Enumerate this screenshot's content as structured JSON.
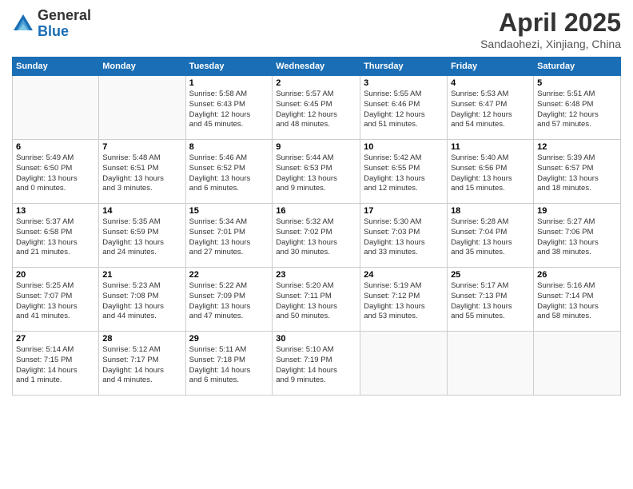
{
  "logo": {
    "general": "General",
    "blue": "Blue"
  },
  "title": "April 2025",
  "location": "Sandaohezi, Xinjiang, China",
  "weekdays": [
    "Sunday",
    "Monday",
    "Tuesday",
    "Wednesday",
    "Thursday",
    "Friday",
    "Saturday"
  ],
  "weeks": [
    [
      {
        "day": "",
        "info": ""
      },
      {
        "day": "",
        "info": ""
      },
      {
        "day": "1",
        "info": "Sunrise: 5:58 AM\nSunset: 6:43 PM\nDaylight: 12 hours\nand 45 minutes."
      },
      {
        "day": "2",
        "info": "Sunrise: 5:57 AM\nSunset: 6:45 PM\nDaylight: 12 hours\nand 48 minutes."
      },
      {
        "day": "3",
        "info": "Sunrise: 5:55 AM\nSunset: 6:46 PM\nDaylight: 12 hours\nand 51 minutes."
      },
      {
        "day": "4",
        "info": "Sunrise: 5:53 AM\nSunset: 6:47 PM\nDaylight: 12 hours\nand 54 minutes."
      },
      {
        "day": "5",
        "info": "Sunrise: 5:51 AM\nSunset: 6:48 PM\nDaylight: 12 hours\nand 57 minutes."
      }
    ],
    [
      {
        "day": "6",
        "info": "Sunrise: 5:49 AM\nSunset: 6:50 PM\nDaylight: 13 hours\nand 0 minutes."
      },
      {
        "day": "7",
        "info": "Sunrise: 5:48 AM\nSunset: 6:51 PM\nDaylight: 13 hours\nand 3 minutes."
      },
      {
        "day": "8",
        "info": "Sunrise: 5:46 AM\nSunset: 6:52 PM\nDaylight: 13 hours\nand 6 minutes."
      },
      {
        "day": "9",
        "info": "Sunrise: 5:44 AM\nSunset: 6:53 PM\nDaylight: 13 hours\nand 9 minutes."
      },
      {
        "day": "10",
        "info": "Sunrise: 5:42 AM\nSunset: 6:55 PM\nDaylight: 13 hours\nand 12 minutes."
      },
      {
        "day": "11",
        "info": "Sunrise: 5:40 AM\nSunset: 6:56 PM\nDaylight: 13 hours\nand 15 minutes."
      },
      {
        "day": "12",
        "info": "Sunrise: 5:39 AM\nSunset: 6:57 PM\nDaylight: 13 hours\nand 18 minutes."
      }
    ],
    [
      {
        "day": "13",
        "info": "Sunrise: 5:37 AM\nSunset: 6:58 PM\nDaylight: 13 hours\nand 21 minutes."
      },
      {
        "day": "14",
        "info": "Sunrise: 5:35 AM\nSunset: 6:59 PM\nDaylight: 13 hours\nand 24 minutes."
      },
      {
        "day": "15",
        "info": "Sunrise: 5:34 AM\nSunset: 7:01 PM\nDaylight: 13 hours\nand 27 minutes."
      },
      {
        "day": "16",
        "info": "Sunrise: 5:32 AM\nSunset: 7:02 PM\nDaylight: 13 hours\nand 30 minutes."
      },
      {
        "day": "17",
        "info": "Sunrise: 5:30 AM\nSunset: 7:03 PM\nDaylight: 13 hours\nand 33 minutes."
      },
      {
        "day": "18",
        "info": "Sunrise: 5:28 AM\nSunset: 7:04 PM\nDaylight: 13 hours\nand 35 minutes."
      },
      {
        "day": "19",
        "info": "Sunrise: 5:27 AM\nSunset: 7:06 PM\nDaylight: 13 hours\nand 38 minutes."
      }
    ],
    [
      {
        "day": "20",
        "info": "Sunrise: 5:25 AM\nSunset: 7:07 PM\nDaylight: 13 hours\nand 41 minutes."
      },
      {
        "day": "21",
        "info": "Sunrise: 5:23 AM\nSunset: 7:08 PM\nDaylight: 13 hours\nand 44 minutes."
      },
      {
        "day": "22",
        "info": "Sunrise: 5:22 AM\nSunset: 7:09 PM\nDaylight: 13 hours\nand 47 minutes."
      },
      {
        "day": "23",
        "info": "Sunrise: 5:20 AM\nSunset: 7:11 PM\nDaylight: 13 hours\nand 50 minutes."
      },
      {
        "day": "24",
        "info": "Sunrise: 5:19 AM\nSunset: 7:12 PM\nDaylight: 13 hours\nand 53 minutes."
      },
      {
        "day": "25",
        "info": "Sunrise: 5:17 AM\nSunset: 7:13 PM\nDaylight: 13 hours\nand 55 minutes."
      },
      {
        "day": "26",
        "info": "Sunrise: 5:16 AM\nSunset: 7:14 PM\nDaylight: 13 hours\nand 58 minutes."
      }
    ],
    [
      {
        "day": "27",
        "info": "Sunrise: 5:14 AM\nSunset: 7:15 PM\nDaylight: 14 hours\nand 1 minute."
      },
      {
        "day": "28",
        "info": "Sunrise: 5:12 AM\nSunset: 7:17 PM\nDaylight: 14 hours\nand 4 minutes."
      },
      {
        "day": "29",
        "info": "Sunrise: 5:11 AM\nSunset: 7:18 PM\nDaylight: 14 hours\nand 6 minutes."
      },
      {
        "day": "30",
        "info": "Sunrise: 5:10 AM\nSunset: 7:19 PM\nDaylight: 14 hours\nand 9 minutes."
      },
      {
        "day": "",
        "info": ""
      },
      {
        "day": "",
        "info": ""
      },
      {
        "day": "",
        "info": ""
      }
    ]
  ]
}
